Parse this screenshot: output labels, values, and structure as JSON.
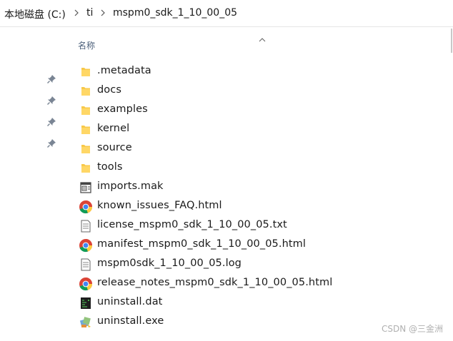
{
  "address": {
    "crumbs": [
      "本地磁盘 (C:)",
      "ti",
      "mspm0_sdk_1_10_00_05"
    ]
  },
  "header": {
    "name_column": "名称"
  },
  "files": [
    {
      "name": ".metadata",
      "icon": "folder-icon"
    },
    {
      "name": "docs",
      "icon": "folder-icon"
    },
    {
      "name": "examples",
      "icon": "folder-icon"
    },
    {
      "name": "kernel",
      "icon": "folder-icon"
    },
    {
      "name": "source",
      "icon": "folder-icon"
    },
    {
      "name": "tools",
      "icon": "folder-icon"
    },
    {
      "name": "imports.mak",
      "icon": "mak-file-icon"
    },
    {
      "name": "known_issues_FAQ.html",
      "icon": "chrome-html-icon"
    },
    {
      "name": "license_mspm0_sdk_1_10_00_05.txt",
      "icon": "text-file-icon"
    },
    {
      "name": "manifest_mspm0_sdk_1_10_00_05.html",
      "icon": "chrome-html-icon"
    },
    {
      "name": "mspm0sdk_1_10_00_05.log",
      "icon": "text-file-icon"
    },
    {
      "name": "release_notes_mspm0_sdk_1_10_00_05.html",
      "icon": "chrome-html-icon"
    },
    {
      "name": "uninstall.dat",
      "icon": "dat-file-icon"
    },
    {
      "name": "uninstall.exe",
      "icon": "exe-file-icon"
    }
  ],
  "watermark": "CSDN @三金洲",
  "colors": {
    "folder": "#f8c94a",
    "header_text": "#4c607a"
  }
}
